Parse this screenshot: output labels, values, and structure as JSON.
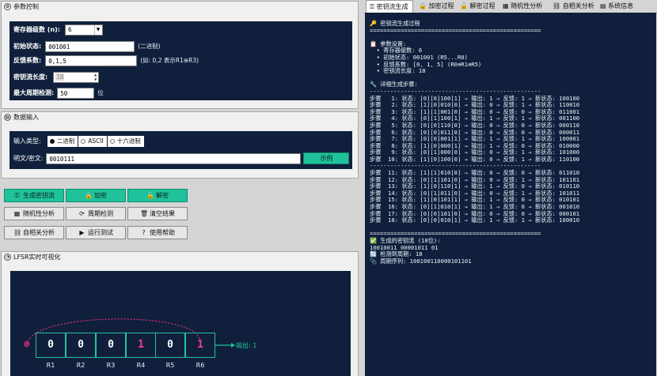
{
  "param_panel": {
    "title": "参数控制",
    "register_label": "寄存器级数 (n):",
    "register_value": "6",
    "initial_label": "初始状态:",
    "initial_value": "001001",
    "initial_hint": "(二进制)",
    "feedback_label": "反馈系数:",
    "feedback_value": "0,1,5",
    "feedback_hint": "(如: 0,2 表示R1⊕R3)",
    "keylen_label": "密钥流长度:",
    "keylen_value": "18",
    "maxperiod_label": "最大周期检测:",
    "maxperiod_value": "50",
    "maxperiod_unit": "位"
  },
  "input_panel": {
    "title": "数据输入",
    "type_label": "输入类型:",
    "options": [
      "二进制",
      "ASCII",
      "十六进制"
    ],
    "selected": "二进制",
    "text_label": "明文/密文:",
    "text_value": "0010111",
    "example_button": "示例"
  },
  "buttons": {
    "generate": "生成密钥流",
    "encrypt": "加密",
    "decrypt": "解密",
    "randomness": "随机性分析",
    "period": "周期检测",
    "clear": "清空结果",
    "autocorr": "自相关分析",
    "run_test": "运行测试",
    "help": "使用帮助"
  },
  "viz_panel": {
    "title": "LFSR实时可视化",
    "cells": [
      "0",
      "0",
      "0",
      "1",
      "0",
      "1"
    ],
    "labels": [
      "R1",
      "R2",
      "R3",
      "R4",
      "R5",
      "R6"
    ],
    "output_text": "输出: 1",
    "xor_symbol": "⊕"
  },
  "tabs": [
    "密钥流生成",
    "加密过程",
    "解密过程",
    "随机性分析",
    "自相关分析",
    "系统信息"
  ],
  "active_tab": "密钥流生成",
  "output_lines": [
    "🔑 密钥流生成过程",
    "==================================================",
    "",
    "📋 参数设置:",
    "  • 寄存器级数: 6",
    "  • 初始状态: 001001 (R5...R0)",
    "  • 反馈系数: [0, 1, 5] (R0⊕R1⊕R5)",
    "  • 密钥流长度: 18",
    "",
    "🔧 详细生成步骤:",
    "--------------------------------------------------",
    "步骤   1: 状态: [0][0]100[1] → 输出: 1 → 反馈: 1 → 新状态: 100100",
    "步骤   2: 状态: [1][0]010[0] → 输出: 0 → 反馈: 1 → 新状态: 110010",
    "步骤   3: 状态: [1][1]001[0] → 输出: 0 → 反馈: 0 → 新状态: 011001",
    "步骤   4: 状态: [0][1]100[1] → 输出: 1 → 反馈: 1 → 新状态: 001100",
    "步骤   5: 状态: [0][0]110[0] → 输出: 0 → 反馈: 0 → 新状态: 000110",
    "步骤   6: 状态: [0][0]011[0] → 输出: 0 → 反馈: 0 → 新状态: 000011",
    "步骤   7: 状态: [0][0]001[1] → 输出: 1 → 反馈: 1 → 新状态: 100001",
    "步骤   8: 状态: [1][0]000[1] → 输出: 1 → 反馈: 0 → 新状态: 010000",
    "步骤   9: 状态: [0][1]000[0] → 输出: 0 → 反馈: 1 → 新状态: 101000",
    "步骤  10: 状态: [1][0]100[0] → 输出: 0 → 反馈: 1 → 新状态: 110100",
    "--------------------------------------------------",
    "步骤  11: 状态: [1][1]010[0] → 输出: 0 → 反馈: 0 → 新状态: 011010",
    "步骤  12: 状态: [0][1]101[0] → 输出: 0 → 反馈: 1 → 新状态: 101101",
    "步骤  13: 状态: [1][0]110[1] → 输出: 1 → 反馈: 0 → 新状态: 010110",
    "步骤  14: 状态: [0][1]011[0] → 输出: 0 → 反馈: 1 → 新状态: 101011",
    "步骤  15: 状态: [1][0]101[1] → 输出: 1 → 反馈: 0 → 新状态: 010101",
    "步骤  16: 状态: [0][1]010[1] → 输出: 1 → 反馈: 0 → 新状态: 001010",
    "步骤  17: 状态: [0][0]101[0] → 输出: 0 → 反馈: 0 → 新状态: 000101",
    "步骤  18: 状态: [0][0]010[1] → 输出: 1 → 反馈: 1 → 新状态: 100010",
    "",
    "==================================================",
    "✅ 生成的密钥流 (18位):",
    "10010011 00001011 01",
    "🔄 检测到周期: 18",
    "📎 周期序列: 100100110000101101"
  ]
}
